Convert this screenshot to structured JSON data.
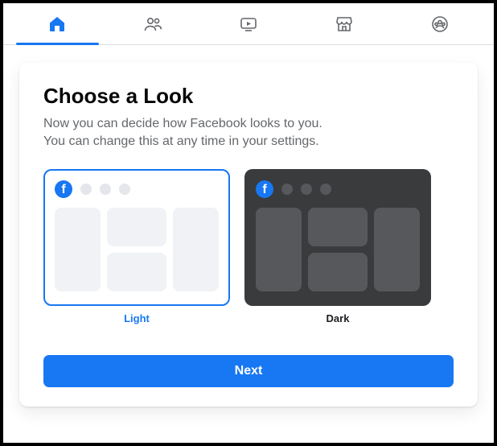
{
  "nav": {
    "active": "home"
  },
  "dialog": {
    "title": "Choose a Look",
    "subtitle_line1": "Now you can decide how Facebook looks to you.",
    "subtitle_line2": "You can change this at any time in your settings.",
    "options": {
      "light": {
        "label": "Light",
        "selected": true
      },
      "dark": {
        "label": "Dark",
        "selected": false
      }
    },
    "next_label": "Next"
  },
  "colors": {
    "accent": "#1877f2",
    "text_secondary": "#65676b",
    "dark_preview_bg": "#3a3b3c"
  }
}
